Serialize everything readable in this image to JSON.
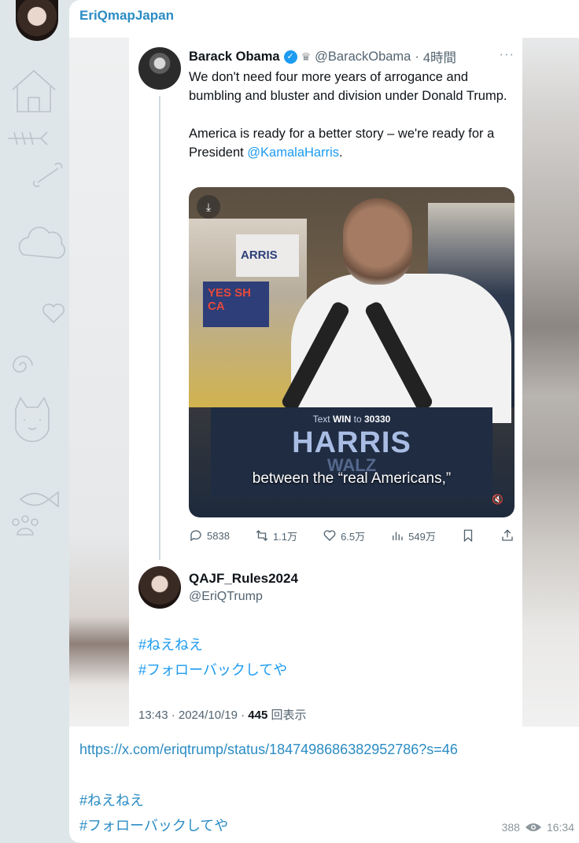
{
  "chat": {
    "sender_name": "EriQmapJapan",
    "link_url": "https://x.com/eriqtrump/status/1847498686382952786?s=46",
    "hashtags": [
      "#ねえねえ",
      "#フォローバックしてや"
    ],
    "views": "388",
    "time": "16:34",
    "eye_icon": "eye-icon"
  },
  "tweet": {
    "author_name": "Barack Obama",
    "author_handle": "@BarackObama",
    "age": "4時間",
    "more": "···",
    "text_para1": "We don't need four more years of arrogance and bumbling and bluster and division under Donald Trump.",
    "text_para2_prefix": "America is ready for a better story – we're ready for a President ",
    "text_para2_mention": "@KamalaHarris",
    "text_para2_suffix": ".",
    "video": {
      "sign_yes": "YES SH CA",
      "shirt_text": "ARRIS",
      "podium_prefix": "Text ",
      "podium_win": "WIN",
      "podium_mid": " to ",
      "podium_number": "30330",
      "podium_harris": "HARRIS",
      "podium_walz": "WALZ",
      "caption": "between the “real Americans,”"
    },
    "stats": {
      "replies": "5838",
      "retweets": "1.1万",
      "likes": "6.5万",
      "views": "549万"
    }
  },
  "quote": {
    "author_name": "QAJF_Rules2024",
    "author_handle": "@EriQTrump",
    "hashtags": [
      "#ねえねえ",
      "#フォローバックしてや"
    ],
    "time_date": "13:43 · 2024/10/19 · ",
    "view_count": "445",
    "view_label": " 回表示"
  },
  "colors": {
    "link": "#2b8cc4",
    "twitter_blue": "#1d9bf0",
    "text": "#0f1419",
    "muted": "#536471"
  }
}
